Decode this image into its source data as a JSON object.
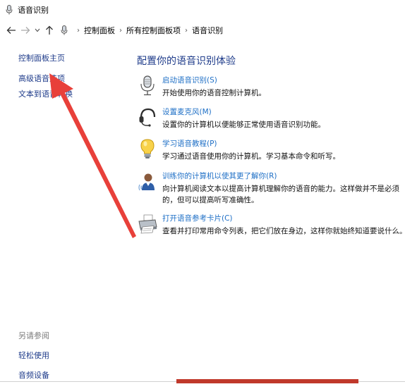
{
  "window": {
    "title": "语音识别"
  },
  "address": {
    "back": "←",
    "forward": "→",
    "recent": "⌄",
    "up": "↑",
    "crumbs": [
      "控制面板",
      "所有控制面板项",
      "语音识别"
    ]
  },
  "sidebar": {
    "links": [
      "控制面板主页",
      "高级语音选项",
      "文本到语音转换"
    ]
  },
  "see_also": {
    "heading": "另请参阅",
    "links": [
      "轻松使用",
      "音频设备"
    ]
  },
  "main": {
    "heading": "配置你的语音识别体验",
    "tasks": [
      {
        "icon": "microphone-icon",
        "link": "启动语音识别(S)",
        "desc": "开始使用你的语音控制计算机。"
      },
      {
        "icon": "headset-icon",
        "link": "设置麦克风(M)",
        "desc": "设置你的计算机以便能够正常使用语音识别功能。"
      },
      {
        "icon": "lightbulb-icon",
        "link": "学习语音教程(P)",
        "desc": "学习通过语音使用你的计算机。学习基本命令和听写。"
      },
      {
        "icon": "user-icon",
        "link": "训练你的计算机以使其更了解你(R)",
        "desc": "向计算机阅读文本以提高计算机理解你的语音的能力。这样做并不是必须的，但可以提高听写准确性。"
      },
      {
        "icon": "printer-icon",
        "link": "打开语音参考卡片(C)",
        "desc": "查看并打印常用命令列表，把它们放在身边，这样你就始终知道要说什么。"
      }
    ]
  },
  "colors": {
    "link": "#1e3b8a",
    "task_link": "#1e6fc6",
    "annotation_arrow": "#e8403a"
  }
}
